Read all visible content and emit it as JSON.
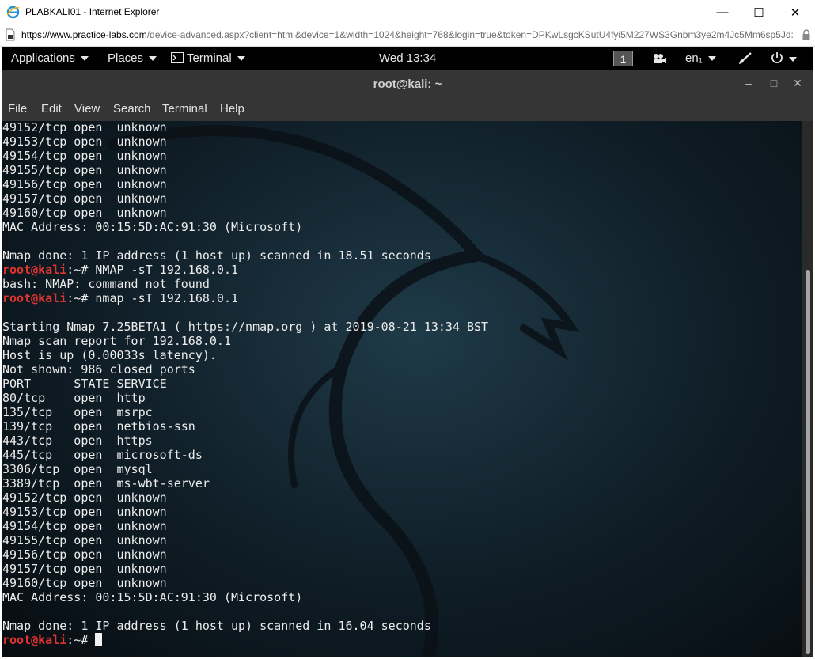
{
  "browser": {
    "title": "PLABKALI01 - Internet Explorer",
    "url_host": "https://www.practice-labs.com",
    "url_rest": "/device-advanced.aspx?client=html&device=1&width=1024&height=768&login=true&token=DPKwLsgcKSutU4fyi5M227WS3Gnbm3ye2m4Jc5Mm6sp5Jd:",
    "minimize": "—",
    "maximize": "☐",
    "close": "✕"
  },
  "gnome_bar": {
    "applications": "Applications",
    "places": "Places",
    "terminal": "Terminal",
    "clock": "Wed 13:34",
    "workspace": "1",
    "language": "en₁"
  },
  "terminal": {
    "title": "root@kali: ~",
    "title_buttons": [
      "‒",
      "□",
      "✕"
    ],
    "menus": [
      "File",
      "Edit",
      "View",
      "Search",
      "Terminal",
      "Help"
    ],
    "lines": [
      {
        "text": "49152/tcp open  unknown"
      },
      {
        "text": "49153/tcp open  unknown"
      },
      {
        "text": "49154/tcp open  unknown"
      },
      {
        "text": "49155/tcp open  unknown"
      },
      {
        "text": "49156/tcp open  unknown"
      },
      {
        "text": "49157/tcp open  unknown"
      },
      {
        "text": "49160/tcp open  unknown"
      },
      {
        "text": "MAC Address: 00:15:5D:AC:91:30 (Microsoft)"
      },
      {
        "text": ""
      },
      {
        "text": "Nmap done: 1 IP address (1 host up) scanned in 18.51 seconds"
      },
      {
        "prompt": "root@kali",
        "suffix": ":~# ",
        "text": "NMAP -sT 192.168.0.1"
      },
      {
        "text": "bash: NMAP: command not found"
      },
      {
        "prompt": "root@kali",
        "suffix": ":~# ",
        "text": "nmap -sT 192.168.0.1"
      },
      {
        "text": ""
      },
      {
        "text": "Starting Nmap 7.25BETA1 ( https://nmap.org ) at 2019-08-21 13:34 BST"
      },
      {
        "text": "Nmap scan report for 192.168.0.1"
      },
      {
        "text": "Host is up (0.00033s latency)."
      },
      {
        "text": "Not shown: 986 closed ports"
      },
      {
        "text": "PORT      STATE SERVICE"
      },
      {
        "text": "80/tcp    open  http"
      },
      {
        "text": "135/tcp   open  msrpc"
      },
      {
        "text": "139/tcp   open  netbios-ssn"
      },
      {
        "text": "443/tcp   open  https"
      },
      {
        "text": "445/tcp   open  microsoft-ds"
      },
      {
        "text": "3306/tcp  open  mysql"
      },
      {
        "text": "3389/tcp  open  ms-wbt-server"
      },
      {
        "text": "49152/tcp open  unknown"
      },
      {
        "text": "49153/tcp open  unknown"
      },
      {
        "text": "49154/tcp open  unknown"
      },
      {
        "text": "49155/tcp open  unknown"
      },
      {
        "text": "49156/tcp open  unknown"
      },
      {
        "text": "49157/tcp open  unknown"
      },
      {
        "text": "49160/tcp open  unknown"
      },
      {
        "text": "MAC Address: 00:15:5D:AC:91:30 (Microsoft)"
      },
      {
        "text": ""
      },
      {
        "text": "Nmap done: 1 IP address (1 host up) scanned in 16.04 seconds"
      },
      {
        "prompt": "root@kali",
        "suffix": ":~# ",
        "text": "",
        "cursor": true
      }
    ]
  }
}
